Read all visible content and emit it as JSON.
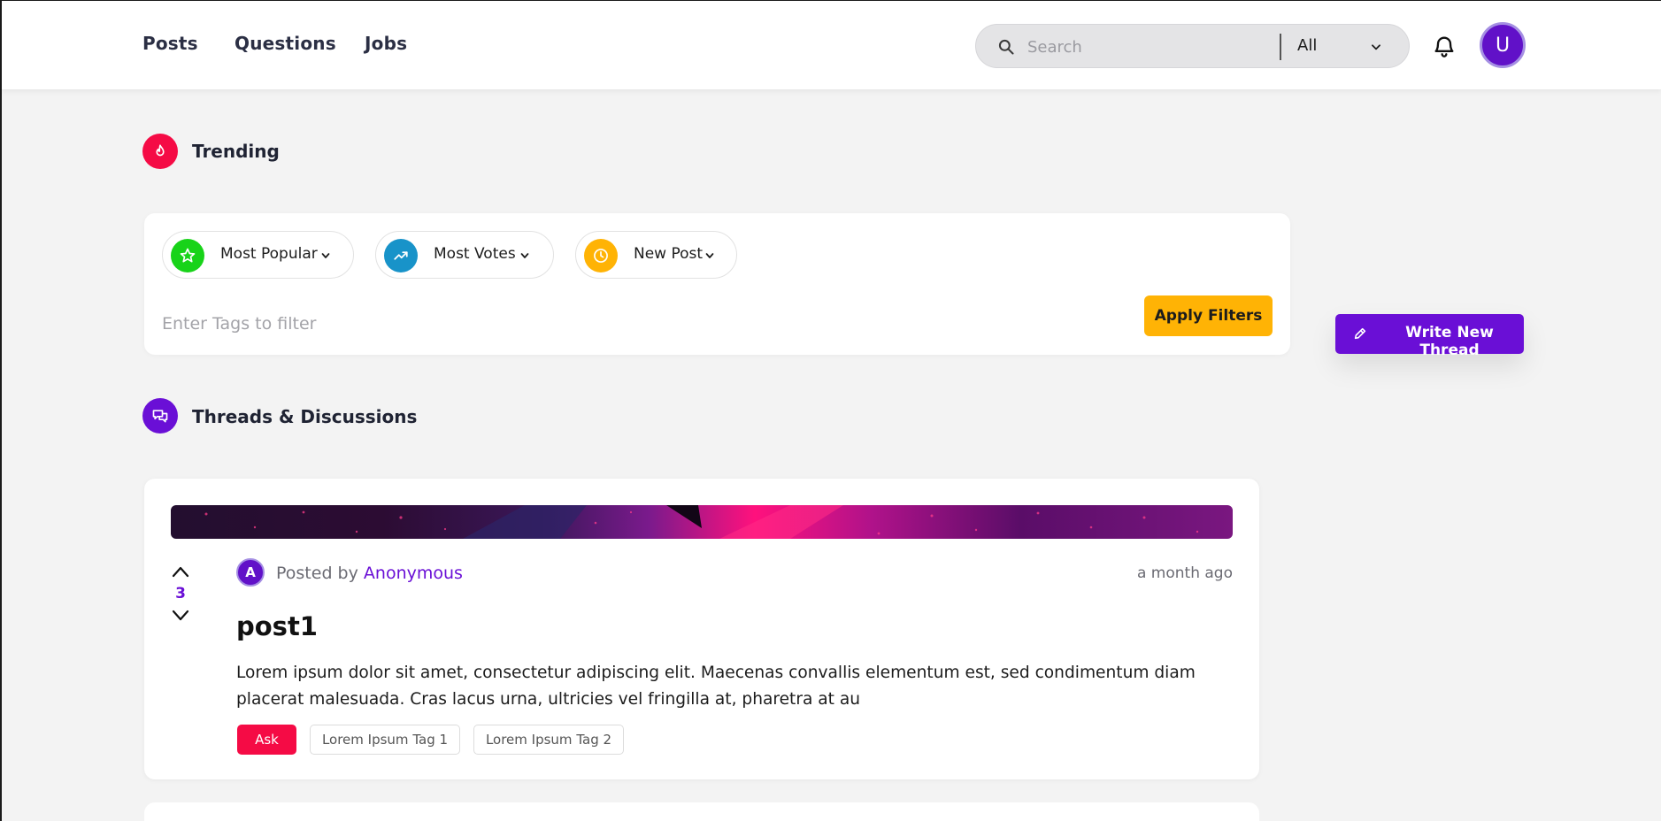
{
  "nav": {
    "links": [
      "Posts",
      "Questions",
      "Jobs"
    ]
  },
  "search": {
    "placeholder": "Search",
    "scope": "All"
  },
  "user": {
    "avatar_letter": "U"
  },
  "trending": {
    "title": "Trending"
  },
  "filters": {
    "chips": [
      {
        "label": "Most Popular",
        "icon": "star-icon",
        "color": "#18d319"
      },
      {
        "label": "Most Votes",
        "icon": "trending-up-icon",
        "color": "#1893c9"
      },
      {
        "label": "New Post",
        "icon": "clock-icon",
        "color": "#ffb305"
      }
    ],
    "tags_placeholder": "Enter Tags to filter",
    "apply_label": "Apply Filters"
  },
  "write_button": {
    "label": "Write New Thread"
  },
  "threads": {
    "title": "Threads & Discussions"
  },
  "post": {
    "votes": "3",
    "avatar_letter": "A",
    "posted_by_prefix": "Posted by",
    "author": "Anonymous",
    "time": "a month ago",
    "title": "post1",
    "body": "Lorem ipsum dolor sit amet, consectetur adipiscing elit. Maecenas convallis elementum est, sed condimentum diam placerat malesuada. Cras lacus urna, ultricies vel fringilla at, pharetra at au",
    "tags": [
      "Ask",
      "Lorem Ipsum Tag 1",
      "Lorem Ipsum Tag 2"
    ]
  },
  "colors": {
    "accent_purple": "#6a0fd6",
    "trending_red": "#f50b45",
    "apply_yellow": "#ffb305"
  }
}
